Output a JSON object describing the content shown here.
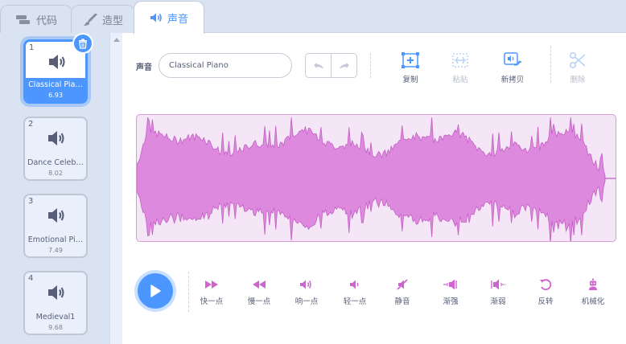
{
  "tabs": [
    {
      "label": "代码",
      "icon": "code-blocks-icon"
    },
    {
      "label": "造型",
      "icon": "paintbrush-icon"
    },
    {
      "label": "声音",
      "icon": "speaker-icon",
      "active": true
    }
  ],
  "sounds": [
    {
      "index": "1",
      "name": "Classical Pia…",
      "duration": "6.93",
      "selected": true
    },
    {
      "index": "2",
      "name": "Dance Celeb…",
      "duration": "8.02"
    },
    {
      "index": "3",
      "name": "Emotional Pi…",
      "duration": "7.49"
    },
    {
      "index": "4",
      "name": "Medieval1",
      "duration": "9.68"
    }
  ],
  "editor": {
    "name_label": "声音",
    "name_value": "Classical Piano",
    "tools": {
      "copy": "复制",
      "paste": "粘贴",
      "copy_new": "新拷贝",
      "delete": "删除"
    }
  },
  "effects": {
    "faster": "快一点",
    "slower": "慢一点",
    "louder": "响一点",
    "softer": "轻一点",
    "mute": "静音",
    "fade_in": "渐强",
    "fade_out": "渐弱",
    "reverse": "反转",
    "robot": "机械化"
  },
  "colors": {
    "accent": "#4c97ff",
    "sound_purple": "#cf63cf",
    "waveform_fill": "#dd8ade",
    "waveform_bg": "#f5e6f7"
  }
}
